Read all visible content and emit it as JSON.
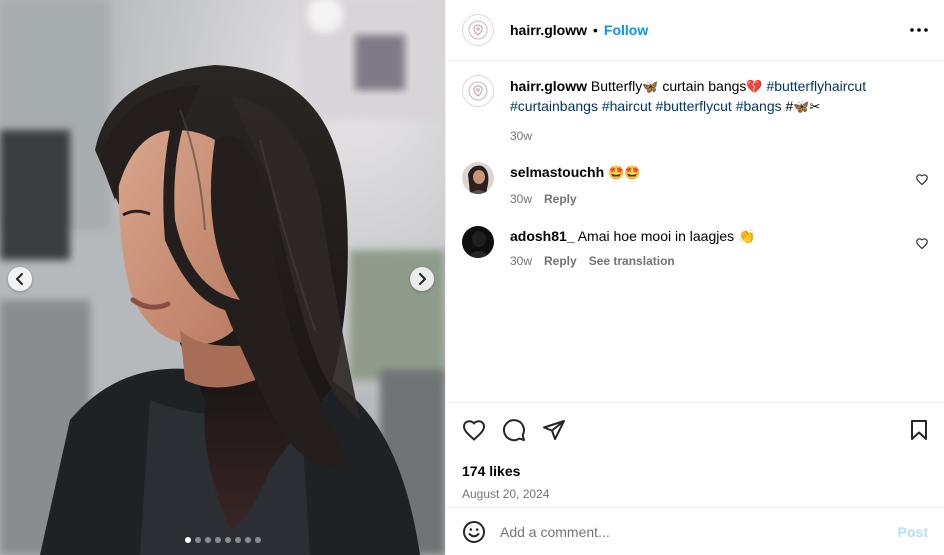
{
  "post": {
    "username": "hairr.gloww",
    "separator": "•",
    "follow_label": "Follow",
    "more_icon": "more-horizontal-icon",
    "carousel": {
      "total_slides": 8,
      "active_slide": 1
    }
  },
  "caption": {
    "username": "hairr.gloww",
    "text_1": "Butterfly",
    "emoji_1": "🦋",
    "text_2": " curtain bangs",
    "emoji_2": "💔",
    "tags_line1": " #butterflyhaircut",
    "tags_line2": "#curtainbangs #haircut #butterflycut #bangs",
    "tags_tail": " #",
    "emoji_3": "🦋",
    "emoji_4": "✂",
    "time": "30w"
  },
  "comments": [
    {
      "username": "selmastouchh",
      "text": "🤩🤩",
      "time": "30w",
      "reply_label": "Reply"
    },
    {
      "username": "adosh81_",
      "text": "Amai hoe mooi in laagjes 👏",
      "time": "30w",
      "reply_label": "Reply",
      "translate_label": "See translation"
    }
  ],
  "engagement": {
    "likes": "174 likes",
    "date": "August 20, 2024"
  },
  "composer": {
    "placeholder": "Add a comment...",
    "post_label": "Post"
  },
  "colors": {
    "accent": "#0095f6",
    "hashtag": "#00376b",
    "muted": "#737373",
    "post_disabled": "#b2dffc"
  }
}
